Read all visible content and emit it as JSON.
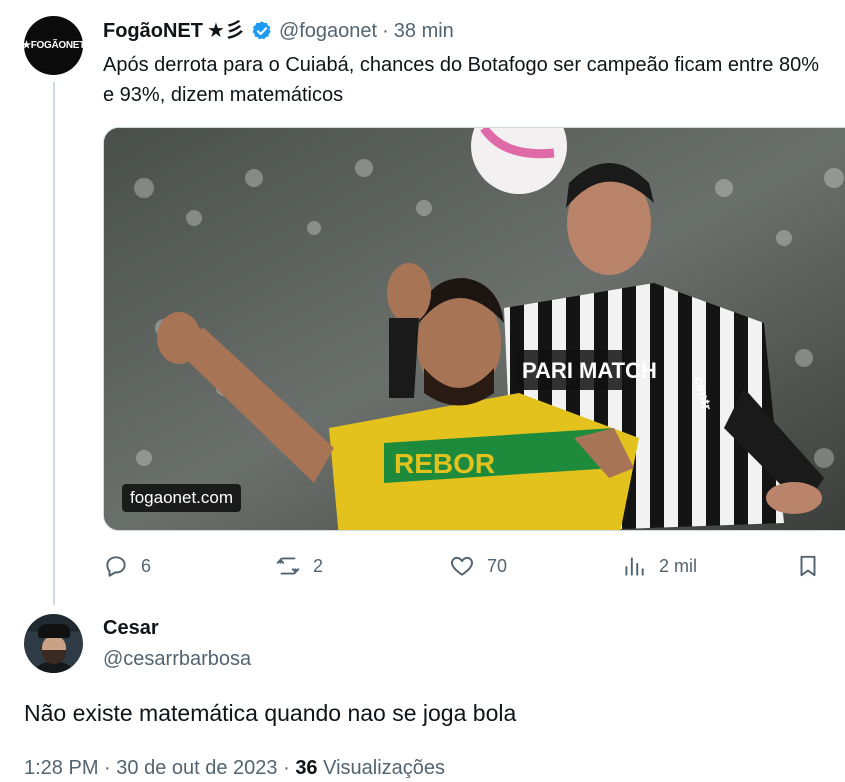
{
  "tweet": {
    "avatar_text": "★FOGÃONET",
    "name": "FogãoNET",
    "name_decoration": "★彡",
    "handle": "@fogaonet",
    "separator": "·",
    "time": "38 min",
    "text": "Após derrota para o Cuiabá, chances do Botafogo ser campeão ficam entre 80% e 93%, dizem matemáticos",
    "media": {
      "badge": "fogaonet.com",
      "jersey_sponsor": "PARI MATCH",
      "yellow_sponsor": "REBOR",
      "sleeve_text": "centr"
    },
    "actions": {
      "reply": {
        "icon": "reply-icon",
        "count": "6"
      },
      "retweet": {
        "icon": "retweet-icon",
        "count": "2"
      },
      "like": {
        "icon": "heart-icon",
        "count": "70"
      },
      "views": {
        "icon": "views-icon",
        "count": "2 mil"
      },
      "bookmark": {
        "icon": "bookmark-icon"
      }
    }
  },
  "reply": {
    "name": "Cesar",
    "handle": "@cesarrbarbosa",
    "text": "Não existe matemática quando nao se joga bola",
    "time": "1:28 PM",
    "date": "30 de out de 2023",
    "views_count": "36",
    "views_label": "Visualizações"
  },
  "colors": {
    "verified": "#1d9bf0",
    "secondary_text": "#536471",
    "primary_text": "#0f1419",
    "thread_line": "#cfd9de"
  }
}
